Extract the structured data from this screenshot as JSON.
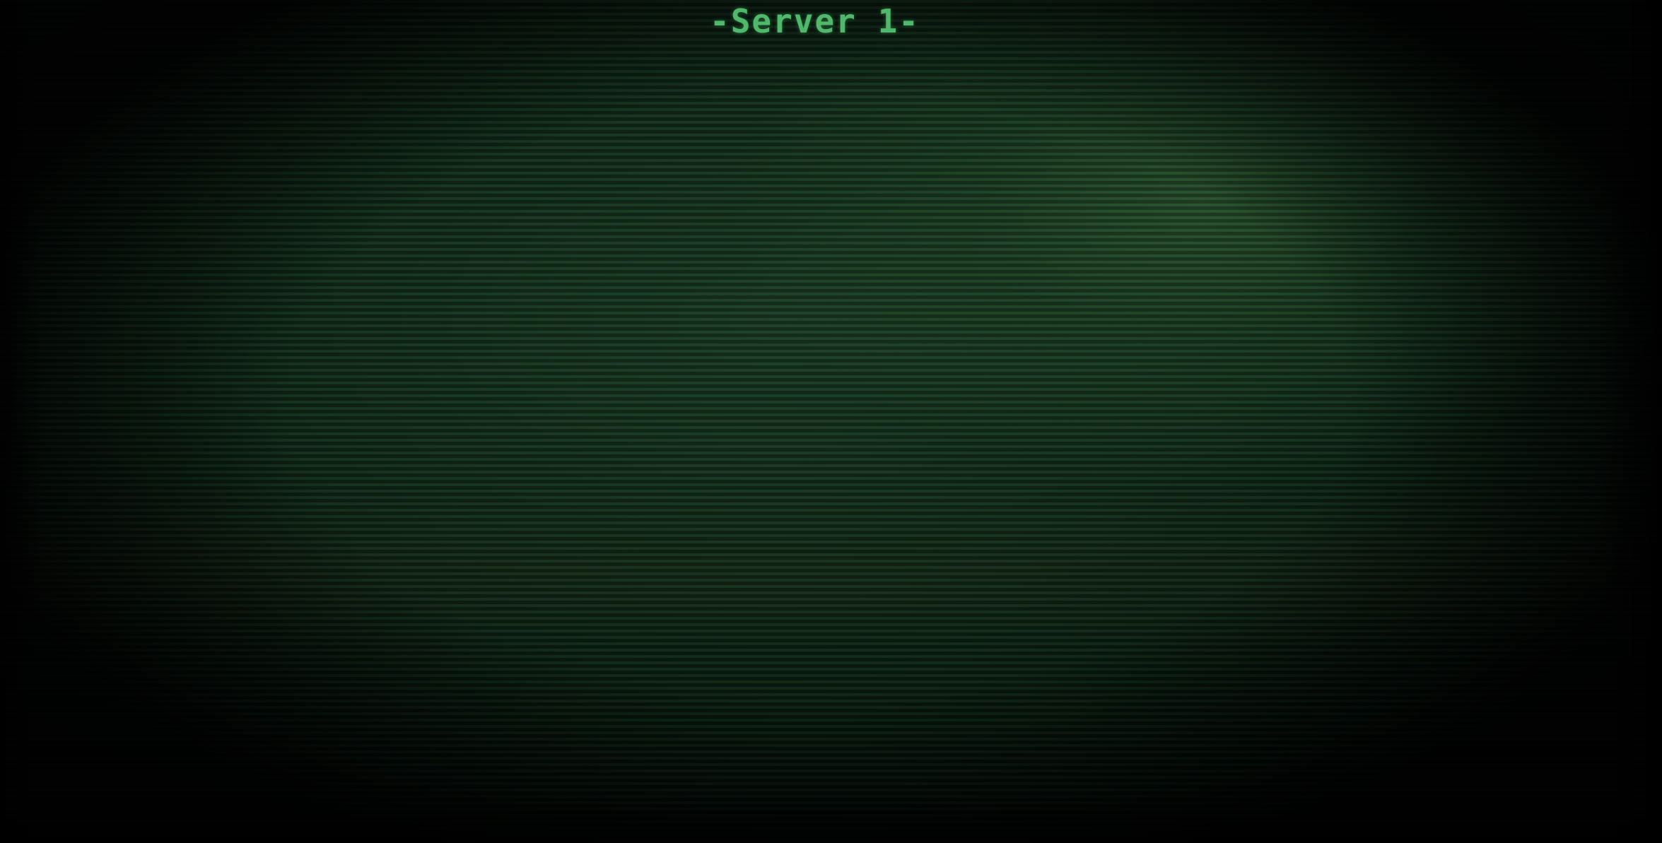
{
  "camera": {
    "title": "-Server 1-"
  },
  "colors": {
    "title_text": "#4fb86a",
    "screen_base": "#112b19"
  }
}
